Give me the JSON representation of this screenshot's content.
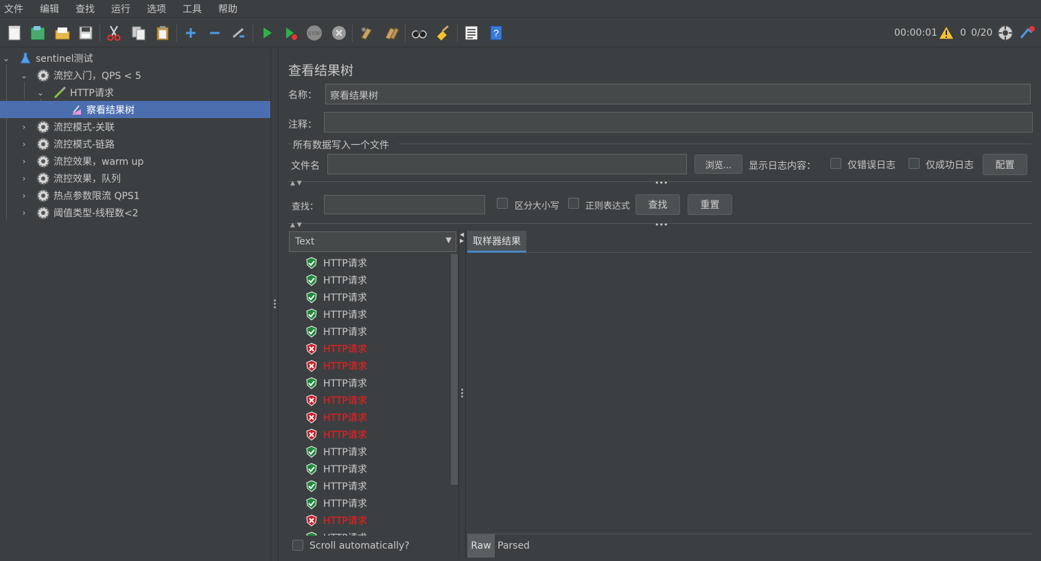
{
  "menu": [
    "文件",
    "编辑",
    "查找",
    "运行",
    "选项",
    "工具",
    "帮助"
  ],
  "toolbar": {
    "time": "00:00:01",
    "warnings": "0",
    "threads": "0/20",
    "icons": [
      "new-icon",
      "templates-icon",
      "open-icon",
      "save-icon",
      "cut-icon",
      "copy-icon",
      "paste-icon",
      "expand-icon",
      "collapse-icon",
      "toggle-icon",
      "start-icon",
      "start-no-pause-icon",
      "stop-icon",
      "shutdown-icon",
      "clear-icon",
      "clear-all-icon",
      "search-icon",
      "reset-search-icon",
      "function-helper-icon",
      "help-icon"
    ]
  },
  "tree": [
    {
      "label": "sentinel测试",
      "level": 0,
      "expanded": true,
      "icon": "flask-icon"
    },
    {
      "label": "流控入门，QPS < 5",
      "level": 1,
      "expanded": true,
      "icon": "gear-icon"
    },
    {
      "label": "HTTP请求",
      "level": 2,
      "expanded": true,
      "icon": "pipette-icon"
    },
    {
      "label": "察看结果树",
      "level": 3,
      "selected": true,
      "icon": "listener-icon"
    },
    {
      "label": "流控模式-关联",
      "level": 1,
      "expanded": false,
      "icon": "gear-icon"
    },
    {
      "label": "流控模式-链路",
      "level": 1,
      "expanded": false,
      "icon": "gear-icon"
    },
    {
      "label": "流控效果，warm up",
      "level": 1,
      "expanded": false,
      "icon": "gear-icon"
    },
    {
      "label": "流控效果，队列",
      "level": 1,
      "expanded": false,
      "icon": "gear-icon"
    },
    {
      "label": "热点参数限流 QPS1",
      "level": 1,
      "expanded": false,
      "icon": "gear-icon"
    },
    {
      "label": "阈值类型-线程数<2",
      "level": 1,
      "expanded": false,
      "icon": "gear-icon"
    }
  ],
  "panel": {
    "title": "查看结果树",
    "name_label": "名称：",
    "name_value": "察看结果树",
    "comment_label": "注释：",
    "comment_value": "",
    "file_group_label": "所有数据写入一个文件",
    "filename_label": "文件名",
    "filename_value": "",
    "browse_button": "浏览...",
    "log_display_label": "显示日志内容：",
    "errors_only_label": "仅错误日志",
    "success_only_label": "仅成功日志",
    "configure_button": "配置",
    "search_label": "查找：",
    "search_value": "",
    "case_sensitive_label": "区分大小写",
    "regex_label": "正则表达式",
    "find_button": "查找",
    "reset_button": "重置",
    "renderer_select": "Text",
    "scroll_auto_label": "Scroll automatically?",
    "sampler_tab": "取样器结果",
    "raw_tab": "Raw",
    "parsed_tab": "Parsed"
  },
  "results": [
    {
      "label": "HTTP请求",
      "status": "ok"
    },
    {
      "label": "HTTP请求",
      "status": "ok"
    },
    {
      "label": "HTTP请求",
      "status": "ok"
    },
    {
      "label": "HTTP请求",
      "status": "ok"
    },
    {
      "label": "HTTP请求",
      "status": "ok"
    },
    {
      "label": "HTTP请求",
      "status": "fail"
    },
    {
      "label": "HTTP请求",
      "status": "fail"
    },
    {
      "label": "HTTP请求",
      "status": "ok"
    },
    {
      "label": "HTTP请求",
      "status": "fail"
    },
    {
      "label": "HTTP请求",
      "status": "fail"
    },
    {
      "label": "HTTP请求",
      "status": "fail"
    },
    {
      "label": "HTTP请求",
      "status": "ok"
    },
    {
      "label": "HTTP请求",
      "status": "ok"
    },
    {
      "label": "HTTP请求",
      "status": "ok"
    },
    {
      "label": "HTTP请求",
      "status": "ok"
    },
    {
      "label": "HTTP请求",
      "status": "fail"
    },
    {
      "label": "HTTP请求",
      "status": "ok"
    }
  ]
}
